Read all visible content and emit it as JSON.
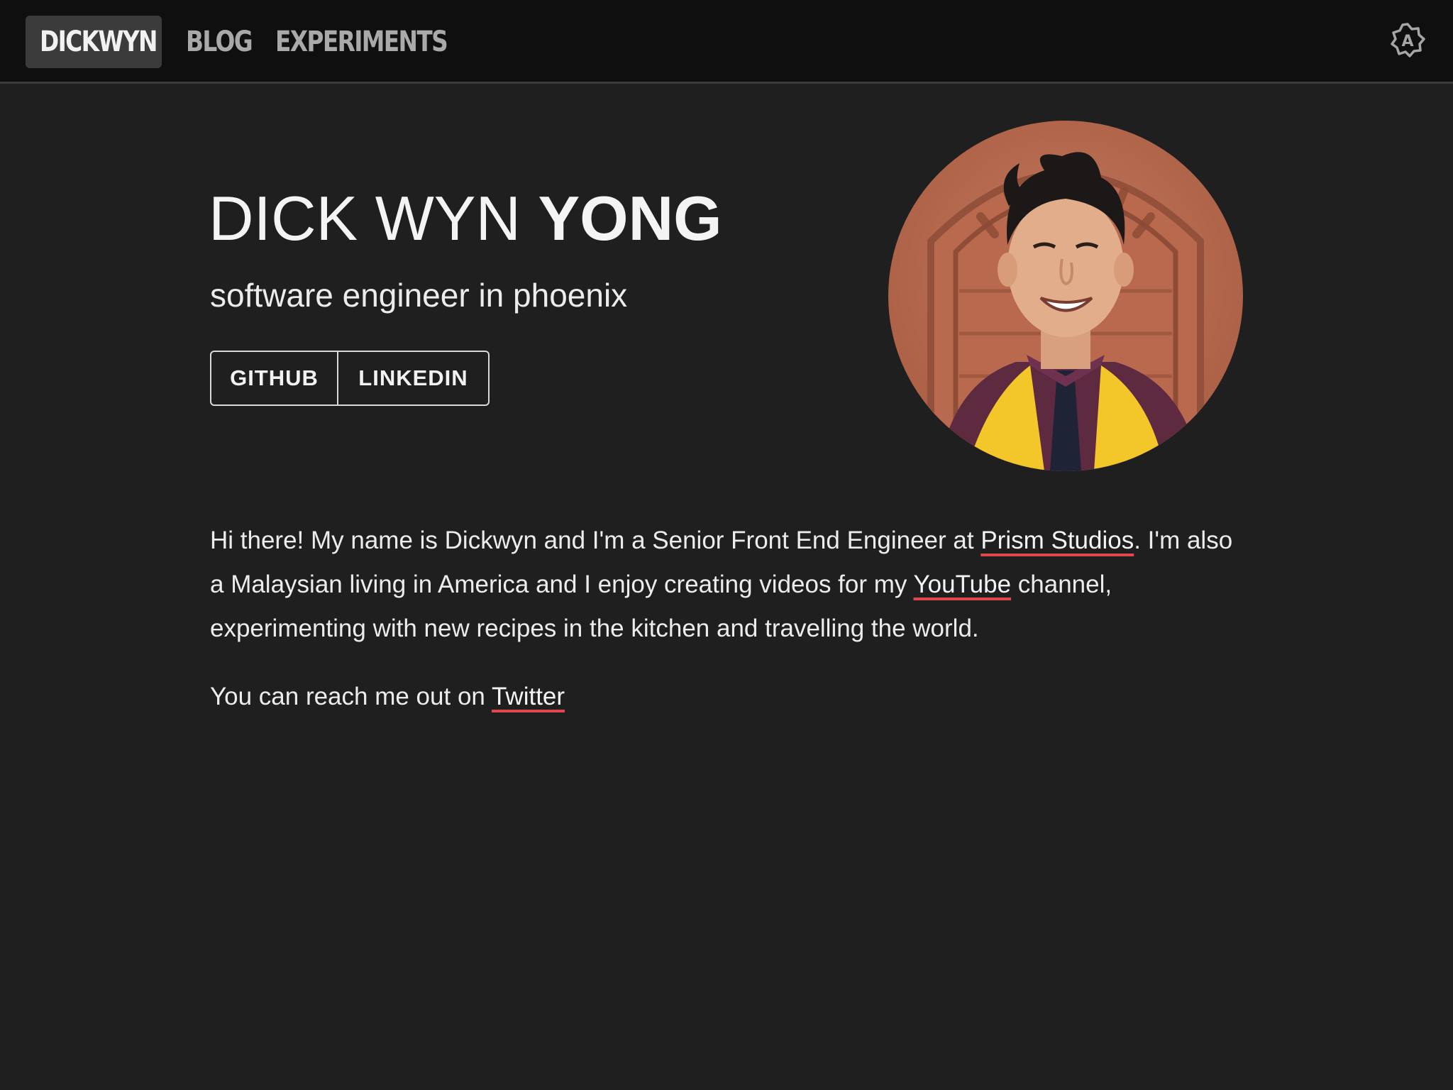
{
  "nav": {
    "brand": "DICKWYN",
    "links": [
      "BLOG",
      "EXPERIMENTS"
    ],
    "theme_toggle_icon": "auto-theme-icon"
  },
  "hero": {
    "first_names": "DICK WYN",
    "last_name": "YONG",
    "subtitle": "software engineer in phoenix",
    "buttons": [
      "GITHUB",
      "LINKEDIN"
    ],
    "avatar_icon": "profile-photo"
  },
  "bio": {
    "part1": "Hi there! My name is Dickwyn and I'm a Senior Front End Engineer at ",
    "link1": "Prism Studios",
    "part2": ". I'm also a Malaysian living in America and I enjoy creating videos for my ",
    "link2": "YouTube",
    "part3": " channel, experimenting with new recipes in the kitchen and travelling the world."
  },
  "contact": {
    "text": "You can reach me out on ",
    "link": "Twitter"
  },
  "colors": {
    "background": "#1f1f1f",
    "nav_background": "#0f0f0f",
    "brand_background": "#3b3b3b",
    "link_underline": "#e0474c"
  }
}
